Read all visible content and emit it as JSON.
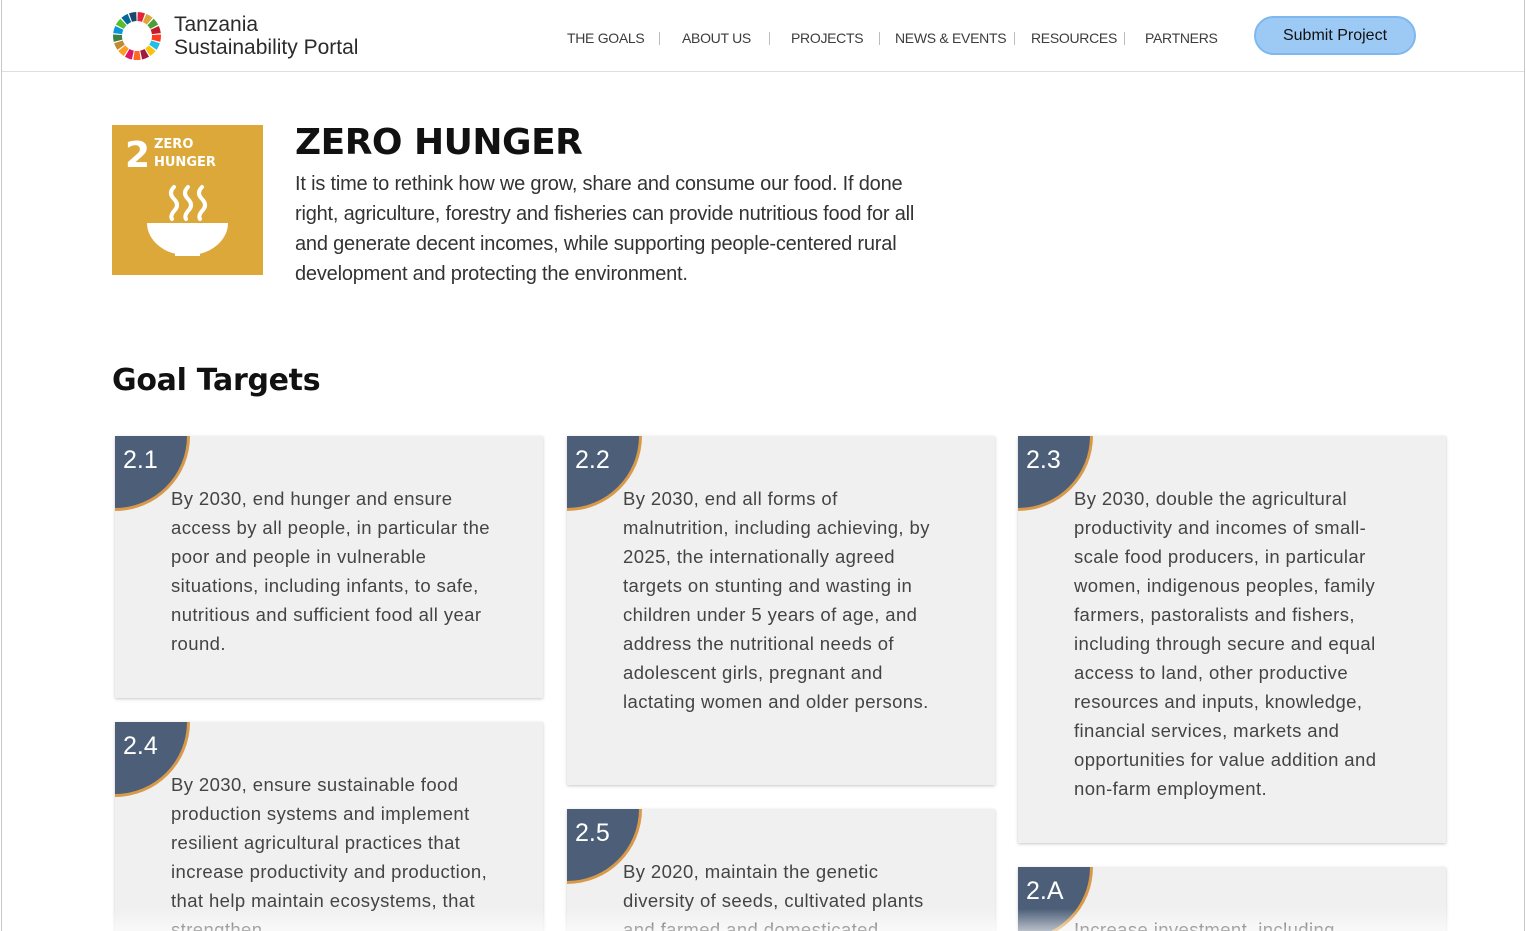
{
  "brand": {
    "line1": "Tanzania",
    "line2": "Sustainability Portal"
  },
  "nav": {
    "items": [
      "THE GOALS",
      "ABOUT US",
      "PROJECTS",
      "NEWS & EVENTS",
      "RESOURCES",
      "PARTNERS"
    ],
    "submit_label": "Submit Project"
  },
  "goal": {
    "number": "2",
    "tile_label_line1": "ZERO",
    "tile_label_line2": "HUNGER",
    "tile_color": "#dda83a",
    "title": "ZERO HUNGER",
    "description": "It is time to rethink how we grow, share and consume our food. If done right, agriculture, forestry and fisheries can provide nutritious food for all and generate decent incomes, while supporting people-centered rural development and protecting the environment."
  },
  "section_title": "Goal Targets",
  "colors": {
    "badge": "#4d5f78",
    "badge_border": "#d89a4a",
    "accent_button": "#9ccaf5"
  },
  "targets": [
    {
      "num": "2.1",
      "text": "By 2030, end hunger and ensure access by all people, in particular the poor and people in vulnerable situations, including infants, to safe, nutritious and sufficient food all year round."
    },
    {
      "num": "2.2",
      "text": "By 2030, end all forms of malnutrition, including achieving, by 2025, the internationally agreed targets on stunting and wasting in children under 5 years of age, and address the nutritional needs of adolescent girls, pregnant and lactating women and older persons."
    },
    {
      "num": "2.3",
      "text": "By 2030, double the agricultural productivity and incomes of small-scale food producers, in particular women, indigenous peoples, family farmers, pastoralists and fishers, including through secure and equal access to land, other productive resources and inputs, knowledge, financial services, markets and opportunities for value addition and non-farm employment."
    },
    {
      "num": "2.4",
      "text": "By 2030, ensure sustainable food production systems and implement resilient agricultural practices that increase productivity and production, that help maintain ecosystems, that strengthen"
    },
    {
      "num": "2.5",
      "text": "By 2020, maintain the genetic diversity of seeds, cultivated plants and farmed and domesticated"
    },
    {
      "num": "2.A",
      "text": "Increase investment, including"
    }
  ]
}
